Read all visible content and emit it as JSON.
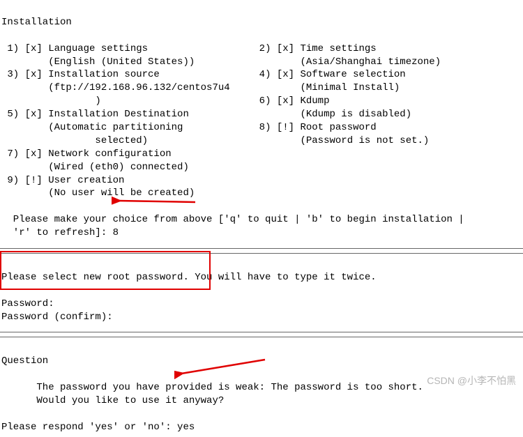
{
  "title": "Installation",
  "menu": {
    "left": [
      {
        "num": "1",
        "mark": "x",
        "label": "Language settings",
        "detail": "(English (United States))"
      },
      {
        "num": "3",
        "mark": "x",
        "label": "Installation source",
        "detail": "(ftp://192.168.96.132/centos7u4\n        )"
      },
      {
        "num": "5",
        "mark": "x",
        "label": "Installation Destination",
        "detail": "(Automatic partitioning\n        selected)"
      },
      {
        "num": "7",
        "mark": "x",
        "label": "Network configuration",
        "detail": "(Wired (eth0) connected)"
      },
      {
        "num": "9",
        "mark": "!",
        "label": "User creation",
        "detail": "(No user will be created)"
      }
    ],
    "right": [
      {
        "num": "2",
        "mark": "x",
        "label": "Time settings",
        "detail": "(Asia/Shanghai timezone)"
      },
      {
        "num": "4",
        "mark": "x",
        "label": "Software selection",
        "detail": "(Minimal Install)"
      },
      {
        "num": "6",
        "mark": "x",
        "label": "Kdump",
        "detail": "(Kdump is disabled)"
      },
      {
        "num": "8",
        "mark": "!",
        "label": "Root password",
        "detail": "(Password is not set.)"
      }
    ]
  },
  "prompt_line": "  Please make your choice from above ['q' to quit | 'b' to begin installation |\n  'r' to refresh]: ",
  "prompt_input": "8",
  "password_section": {
    "heading": "Please select new root password. You will have to type it twice.",
    "label1": "Password:",
    "label2": "Password (confirm):"
  },
  "question_section": {
    "heading": "Question",
    "line1": "      The password you have provided is weak: The password is too short.",
    "line2": "      Would you like to use it anyway?",
    "prompt": "Please respond 'yes' or 'no': ",
    "answer": "yes"
  },
  "watermark": "CSDN @小李不怕黑"
}
